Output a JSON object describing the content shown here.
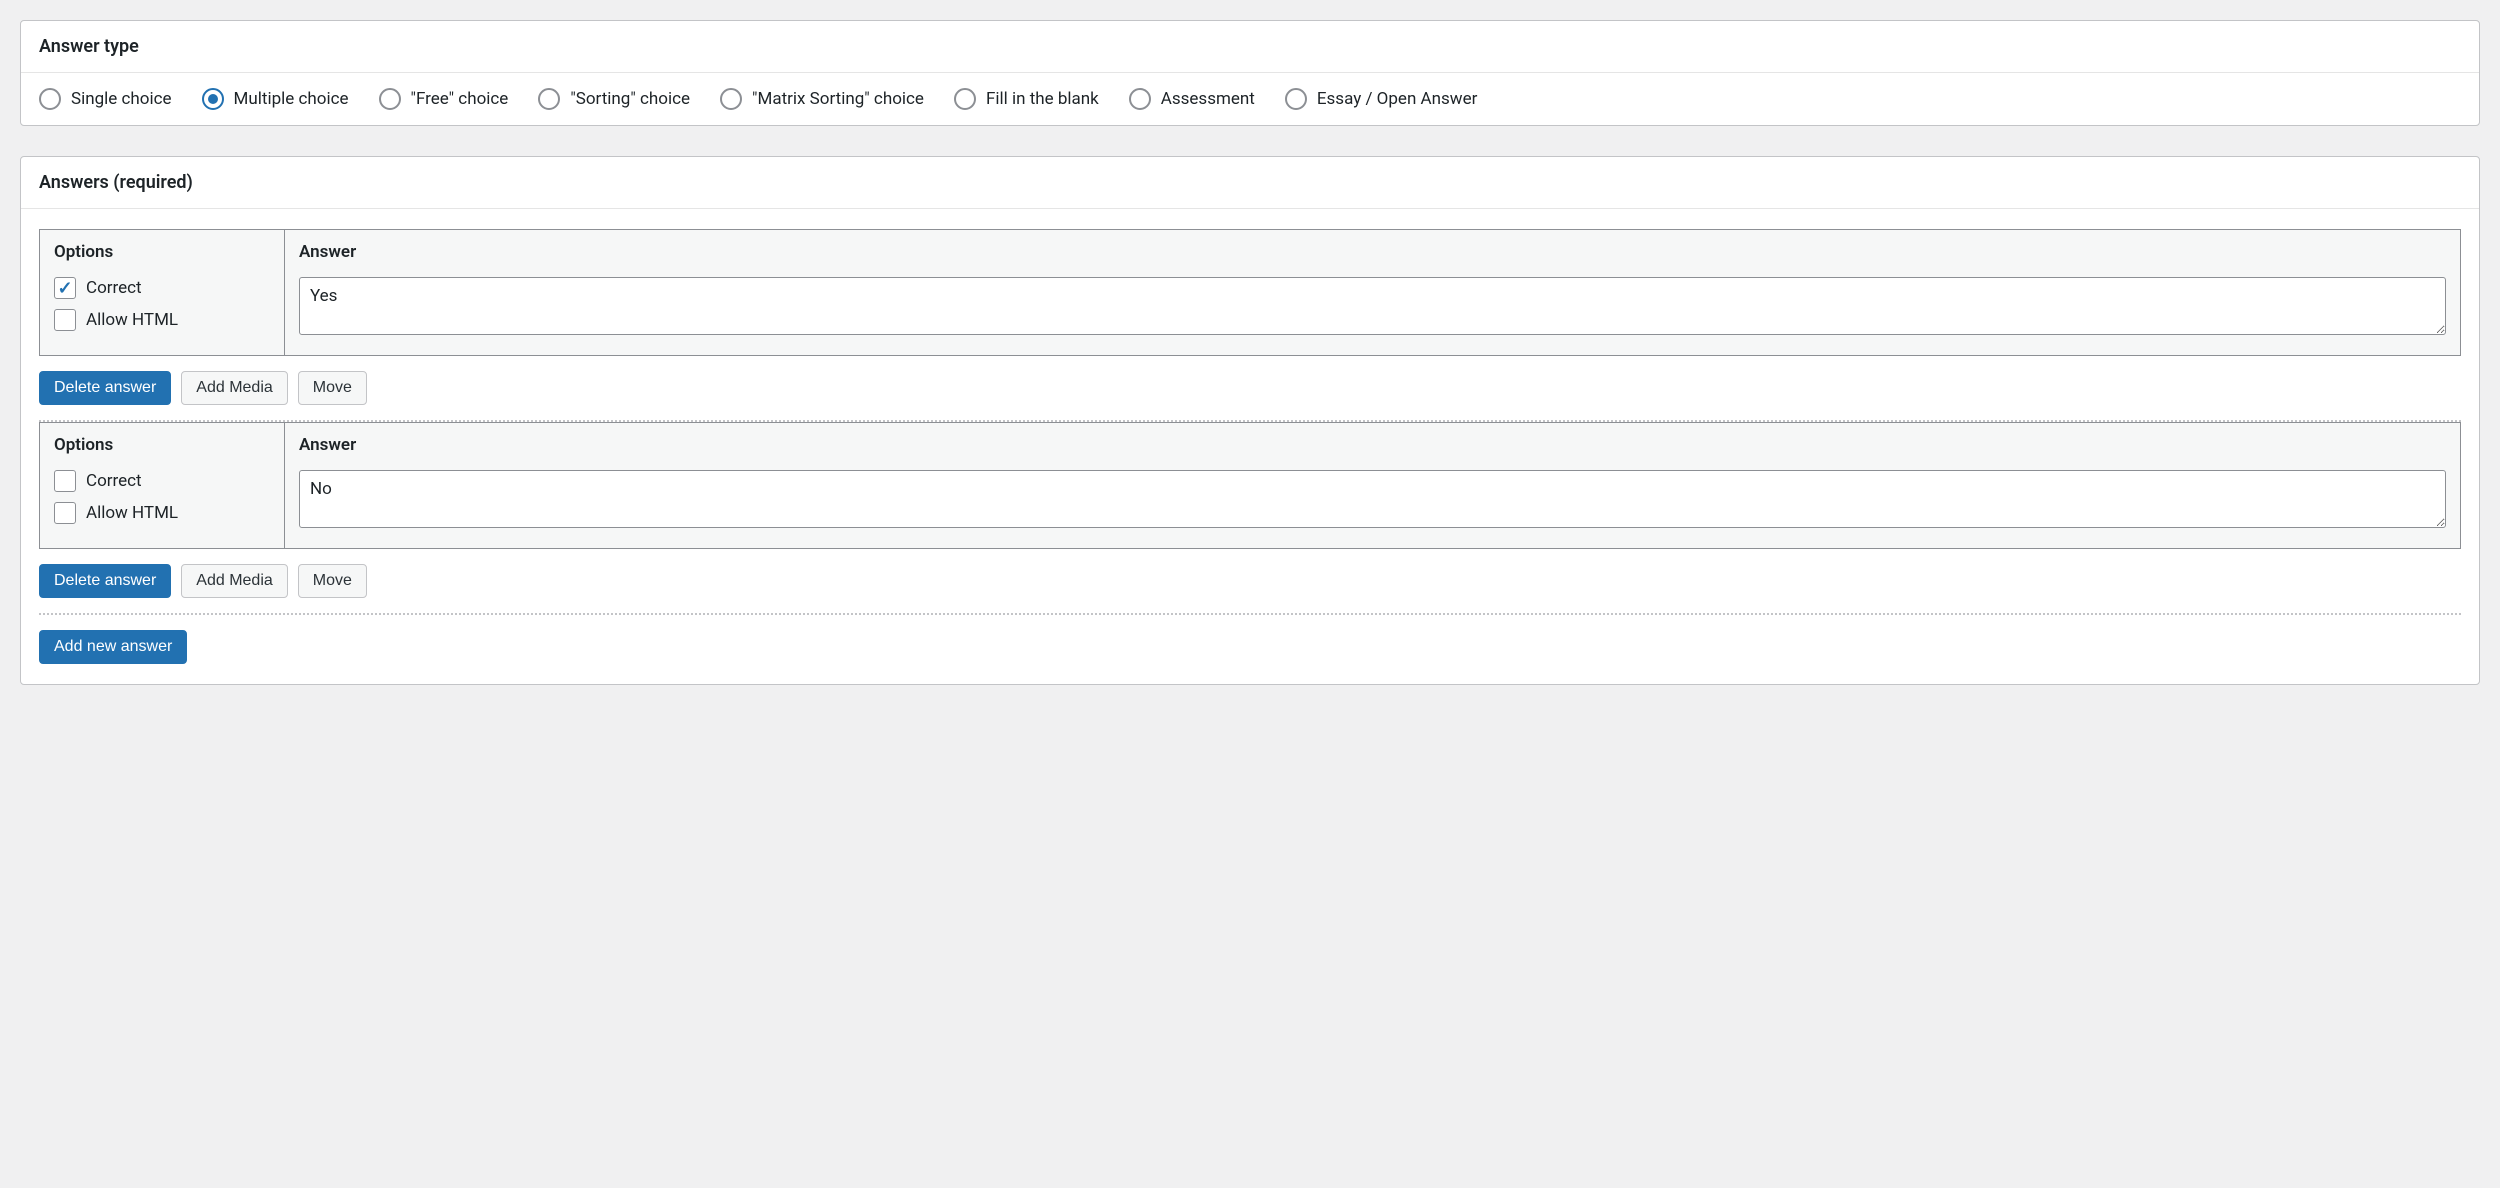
{
  "answer_type_panel": {
    "title": "Answer type",
    "selected": "Multiple choice",
    "options": [
      "Single choice",
      "Multiple choice",
      "\"Free\" choice",
      "\"Sorting\" choice",
      "\"Matrix Sorting\" choice",
      "Fill in the blank",
      "Assessment",
      "Essay / Open Answer"
    ]
  },
  "answers_panel": {
    "title": "Answers (required)",
    "options_header": "Options",
    "answer_header": "Answer",
    "correct_label": "Correct",
    "allow_html_label": "Allow HTML",
    "delete_label": "Delete answer",
    "add_media_label": "Add Media",
    "move_label": "Move",
    "add_new_label": "Add new answer",
    "answers": [
      {
        "text": "Yes",
        "correct": true,
        "allow_html": false
      },
      {
        "text": "No",
        "correct": false,
        "allow_html": false
      }
    ]
  }
}
